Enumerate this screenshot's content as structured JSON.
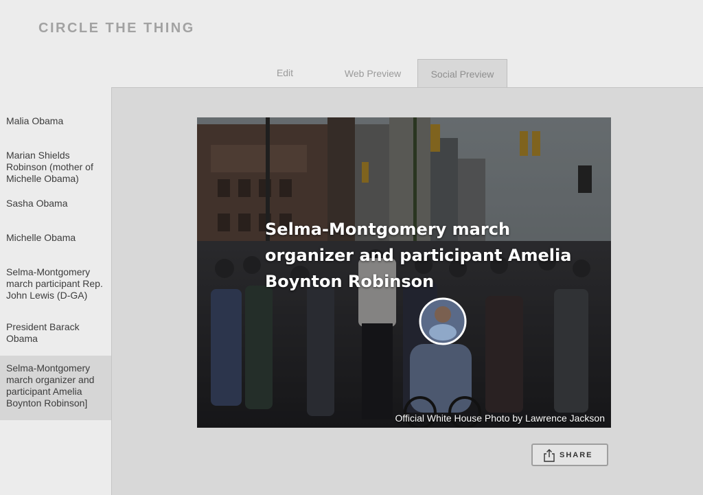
{
  "app": {
    "title": "CIRCLE THE THING"
  },
  "tabs": [
    {
      "label": "Edit"
    },
    {
      "label": "Web Preview"
    },
    {
      "label": "Social Preview"
    }
  ],
  "sidebar": {
    "items": [
      {
        "label": "Malia Obama"
      },
      {
        "label": "Marian Shields Robinson (mother of Michelle Obama)"
      },
      {
        "label": "Sasha Obama"
      },
      {
        "label": "Michelle Obama"
      },
      {
        "label": "Selma-Montgomery march participant Rep. John Lewis (D-GA)"
      },
      {
        "label": "President Barack Obama"
      },
      {
        "label": "Selma-Montgomery march organizer and participant Amelia Boynton Robinson]"
      }
    ],
    "active_index": 6
  },
  "preview": {
    "headline": "Selma-Montgomery march organizer and participant Amelia Boynton Robinson",
    "credit": "Official White House Photo by Lawrence Jackson"
  },
  "actions": {
    "share_label": "SHARE",
    "share_icon": "share-icon"
  },
  "colors": {
    "panel_bg": "#d8d8d8",
    "sidebar_active_bg": "#d6d6d6",
    "title_gray": "#a2a2a2"
  }
}
